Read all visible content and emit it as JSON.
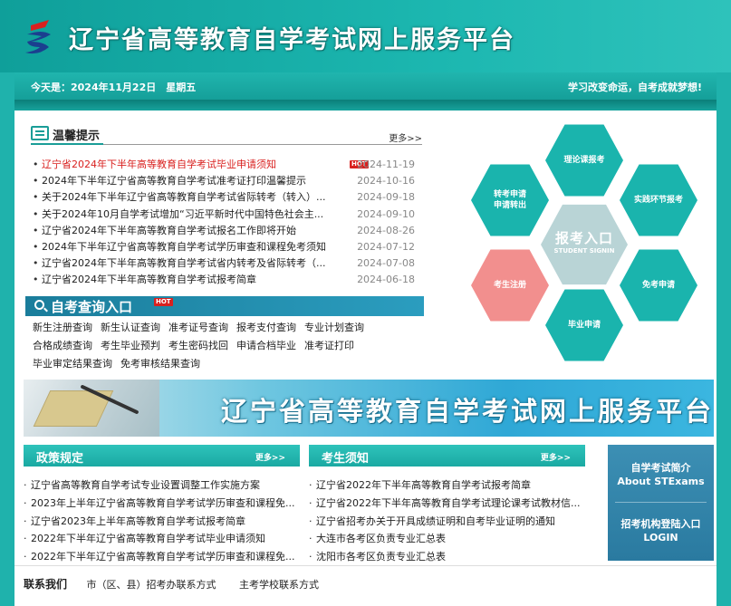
{
  "header": {
    "title": "辽宁省高等教育自学考试网上服务平台",
    "date_text": "今天是：2024年11月22日　星期五",
    "slogan": "学习改变命运，自考成就梦想!"
  },
  "notices": {
    "title": "温馨提示",
    "more": "更多>>",
    "hot_label": "HOT",
    "items": [
      {
        "text": "辽宁省2024年下半年高等教育自学考试毕业申请须知",
        "date": "2024-11-19",
        "hot": true
      },
      {
        "text": "2024年下半年辽宁省高等教育自学考试准考证打印温馨提示",
        "date": "2024-10-16"
      },
      {
        "text": "关于2024年下半年辽宁省高等教育自学考试省际转考（转入）...",
        "date": "2024-09-18"
      },
      {
        "text": "关于2024年10月自学考试增加“习近平新时代中国特色社会主...",
        "date": "2024-09-10"
      },
      {
        "text": "辽宁省2024年下半年高等教育自学考试报名工作即将开始",
        "date": "2024-08-26"
      },
      {
        "text": "2024年下半年辽宁省高等教育自学考试学历审查和课程免考须知",
        "date": "2024-07-12"
      },
      {
        "text": "辽宁省2024年下半年高等教育自学考试省内转考及省际转考（...",
        "date": "2024-07-08"
      },
      {
        "text": "辽宁省2024年下半年高等教育自学考试报考简章",
        "date": "2024-06-18"
      }
    ]
  },
  "query": {
    "title": "自考查询入口",
    "hot_label": "HOT",
    "rows": [
      [
        "新生注册查询",
        "新生认证查询",
        "准考证号查询",
        "报考支付查询",
        "专业计划查询"
      ],
      [
        "合格成绩查询",
        "考生毕业预判",
        "考生密码找回",
        "申请合档毕业",
        "准考证打印"
      ],
      [
        "毕业审定结果查询",
        "免考审核结果查询"
      ]
    ]
  },
  "hexes": {
    "center_title": "报考入口",
    "center_sub": "STUDENT SIGNIN",
    "theory": "理论课报考",
    "transfer": "转考申请\n申请转出",
    "practice": "实践环节报考",
    "register": "考生注册",
    "exempt": "免考申请",
    "graduate": "毕业申请"
  },
  "banner": {
    "title": "辽宁省高等教育自学考试网上服务平台"
  },
  "policy": {
    "title": "政策规定",
    "more": "更多>>",
    "items": [
      "辽宁省高等教育自学考试专业设置调整工作实施方案",
      "2023年上半年辽宁省高等教育自学考试学历审查和课程免...",
      "辽宁省2023年上半年高等教育自学考试报考简章",
      "2022年下半年辽宁省高等教育自学考试毕业申请须知",
      "2022年下半年辽宁省高等教育自学考试学历审查和课程免..."
    ]
  },
  "guide": {
    "title": "考生须知",
    "more": "更多>>",
    "items": [
      "辽宁省2022年下半年高等教育自学考试报考简章",
      "辽宁省2022年下半年高等教育自学考试理论课考试教材信...",
      "辽宁省招考办关于开具成绩证明和自考毕业证明的通知",
      "大连市各考区负责专业汇总表",
      "沈阳市各考区负责专业汇总表"
    ]
  },
  "side": {
    "intro_cn": "自学考试简介",
    "intro_en": "About STExams",
    "login_cn": "招考机构登陆入口",
    "login_en": "LOGIN"
  },
  "contact": {
    "label": "联系我们",
    "links": [
      "市（区、县）招考办联系方式",
      "主考学校联系方式"
    ]
  }
}
